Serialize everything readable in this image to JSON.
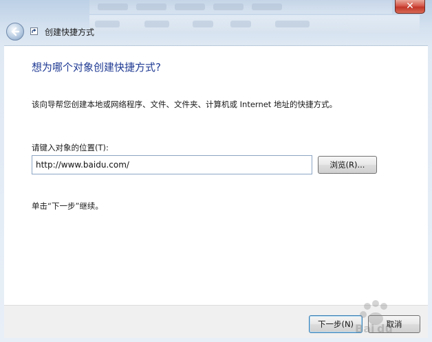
{
  "window": {
    "title": "创建快捷方式",
    "close_label": "✕"
  },
  "wizard": {
    "heading": "想为哪个对象创建快捷方式?",
    "description": "该向导帮您创建本地或网络程序、文件、文件夹、计算机或 Internet 地址的快捷方式。",
    "location_label": "请键入对象的位置(T):",
    "location_value": "http://www.baidu.com/",
    "browse_label": "浏览(R)...",
    "hint": "单击“下一步”继续。"
  },
  "footer": {
    "next_label": "下一步(N)",
    "cancel_label": "取消"
  },
  "watermark": {
    "text": "Baidu经验"
  },
  "colors": {
    "heading": "#1f3a93",
    "close_button": "#c2372a",
    "glass_frame": "#d4e1ef"
  },
  "icons": [
    "back-arrow-icon",
    "shortcut-icon",
    "close-icon"
  ]
}
